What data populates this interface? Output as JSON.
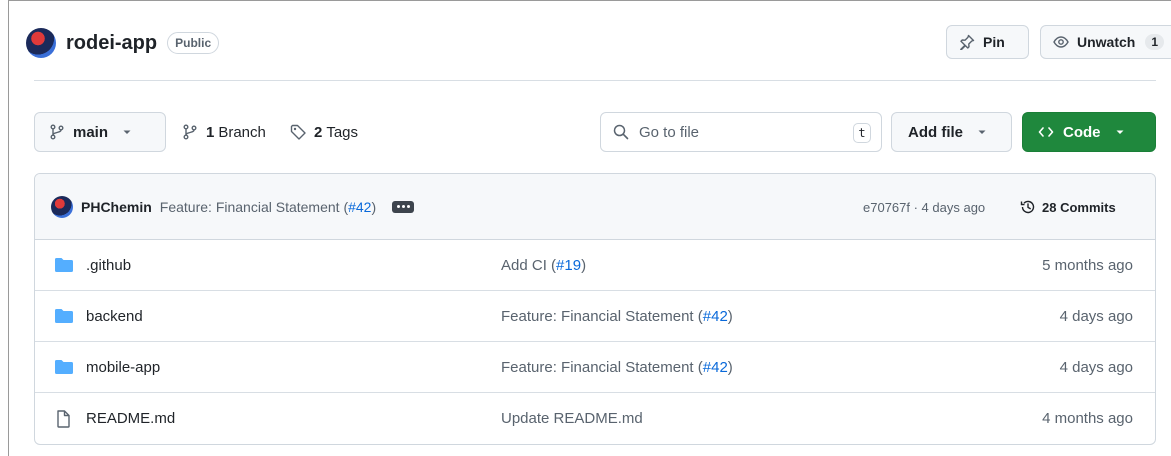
{
  "repo": {
    "name": "rodei-app",
    "visibility": "Public",
    "avatar_colors": [
      "#e03a3a",
      "#1b2a5a",
      "#3a6fd8"
    ]
  },
  "header_actions": {
    "pin_label": "Pin",
    "unwatch_label": "Unwatch",
    "watch_count": "1"
  },
  "toolbar": {
    "branch_name": "main",
    "branches_count": "1",
    "branches_label": "Branch",
    "tags_count": "2",
    "tags_label": "Tags",
    "search_placeholder": "Go to file",
    "search_shortcut": "t",
    "add_file_label": "Add file",
    "code_label": "Code",
    "code_button_color": "#1f883d"
  },
  "latest_commit": {
    "author": "PHChemin",
    "message": "Feature: Financial Statement (",
    "pr_ref": "#42",
    "message_end": ")",
    "hash_and_age": "e70767f · 4 days ago",
    "commits_count_label": "28 Commits"
  },
  "files": [
    {
      "name": ".github",
      "type": "folder",
      "commit_msg": "Add CI (",
      "pr_ref": "#19",
      "commit_msg_end": ")",
      "age": "5 months ago"
    },
    {
      "name": "backend",
      "type": "folder",
      "commit_msg": "Feature: Financial Statement (",
      "pr_ref": "#42",
      "commit_msg_end": ")",
      "age": "4 days ago"
    },
    {
      "name": "mobile-app",
      "type": "folder",
      "commit_msg": "Feature: Financial Statement (",
      "pr_ref": "#42",
      "commit_msg_end": ")",
      "age": "4 days ago"
    },
    {
      "name": "README.md",
      "type": "file",
      "commit_msg": "Update README.md",
      "pr_ref": "",
      "commit_msg_end": "",
      "age": "4 months ago"
    }
  ],
  "icons": {
    "folder_color": "#54aeff",
    "link_color": "#0969da"
  }
}
